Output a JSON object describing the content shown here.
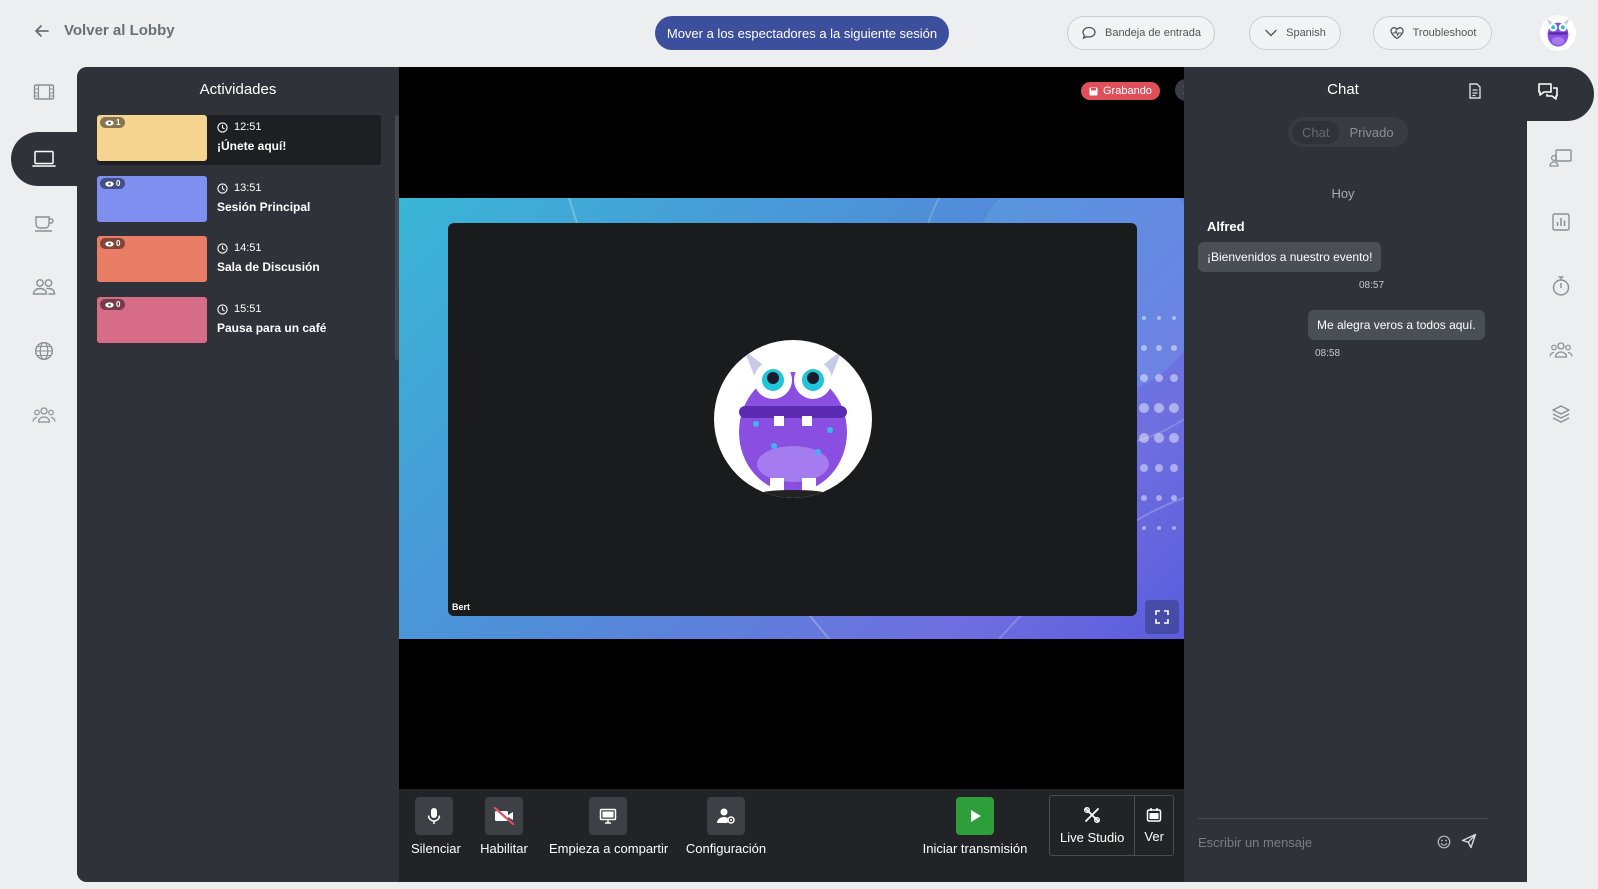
{
  "topbar": {
    "back_label": "Volver al Lobby",
    "move_button": "Mover a los espectadores a la siguiente sesión",
    "inbox_label": "Bandeja de entrada",
    "language_label": "Spanish",
    "troubleshoot_label": "Troubleshoot"
  },
  "left_rail": [
    "film-icon",
    "laptop-icon",
    "coffee-icon",
    "people-icon",
    "globe-icon",
    "group-icon"
  ],
  "activities": {
    "title": "Actividades",
    "items": [
      {
        "time": "12:51",
        "name": "¡Únete aquí!",
        "viewers": "1",
        "color": "#f5d48f",
        "selected": true
      },
      {
        "time": "13:51",
        "name": "Sesión Principal",
        "viewers": "0",
        "color": "#7f8ff0",
        "selected": false
      },
      {
        "time": "14:51",
        "name": "Sala de Discusión",
        "viewers": "0",
        "color": "#ea7d66",
        "selected": false
      },
      {
        "time": "15:51",
        "name": "Pausa para un café",
        "viewers": "0",
        "color": "#d66c88",
        "selected": false
      }
    ]
  },
  "stage": {
    "recording_label": "Grabando",
    "participant_name": "Bert"
  },
  "controls": {
    "mute": "Silenciar",
    "enable": "Habilitar",
    "share": "Empieza a compartir",
    "settings": "Configuración",
    "start_stream": "Iniciar transmisión",
    "live_studio": "Live Studio",
    "view": "Ver"
  },
  "chat": {
    "title": "Chat",
    "tab_chat": "Chat",
    "tab_private": "Privado",
    "day": "Hoy",
    "sender": "Alfred",
    "messages": [
      {
        "text": "¡Bienvenidos a nuestro evento!",
        "time": "08:57"
      },
      {
        "text": "Me alegra veros a todos aquí.",
        "time": "08:58"
      }
    ],
    "input_placeholder": "Escribir un mensaje"
  },
  "colors": {
    "primary": "#3c4f9c",
    "panel": "#2f3238",
    "recording": "#e0505a",
    "stream_green": "#2e9e3a"
  }
}
